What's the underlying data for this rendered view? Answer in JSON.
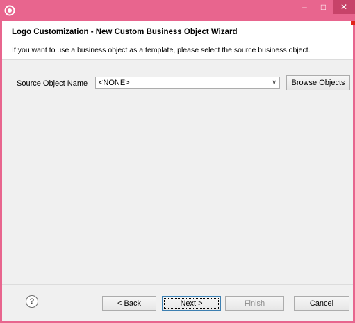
{
  "window": {
    "controls": {
      "minimize": "–",
      "maximize": "□",
      "close": "✕"
    }
  },
  "header": {
    "title": "Logo Customization - New Custom Business Object Wizard",
    "description": "If you want to use a business object as a template, please select the source business object."
  },
  "form": {
    "source_label": "Source Object Name",
    "source_value": "<NONE>",
    "combo_arrow": "∨",
    "browse_label": "Browse Objects"
  },
  "footer": {
    "help": "?",
    "back_label": "< Back",
    "next_label": "Next >",
    "finish_label": "Finish",
    "cancel_label": "Cancel"
  },
  "colors": {
    "title_bar": "#e8658e",
    "close_button": "#c74369",
    "accent": "#e2231a"
  },
  "icons": [
    "app-icon",
    "minimize-icon",
    "maximize-icon",
    "close-icon",
    "help-icon",
    "dropdown-arrow-icon"
  ]
}
